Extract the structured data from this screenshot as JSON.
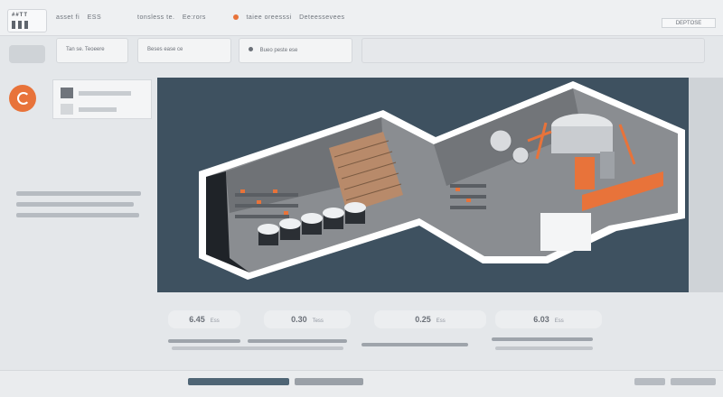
{
  "header": {
    "logo_text": "##TT",
    "nav_items": [
      "asset fi",
      "ESS"
    ],
    "nav_secondary": [
      "tonsless te.",
      "Ee:rors"
    ],
    "nav_tertiary": [
      "taiee oreesssi",
      "Deteessevees"
    ],
    "right_button": "DEPTOSE"
  },
  "subbar": {
    "field_one": "Tan se. Teoeere",
    "field_two": "Beses ease ce",
    "field_three": "Bueo peste ese"
  },
  "hero": {
    "image_name": "isometric factory cutaway illustration"
  },
  "stats": [
    {
      "value": "6.45",
      "label": "Ess"
    },
    {
      "value": "0.30",
      "label": "Tess"
    },
    {
      "value": "0.25",
      "label": "Ess"
    },
    {
      "value": "6.03",
      "label": "Ess"
    }
  ],
  "colors": {
    "accent": "#e8733a",
    "hero_bg": "#3e5160",
    "page_bg": "#e4e7ea"
  }
}
